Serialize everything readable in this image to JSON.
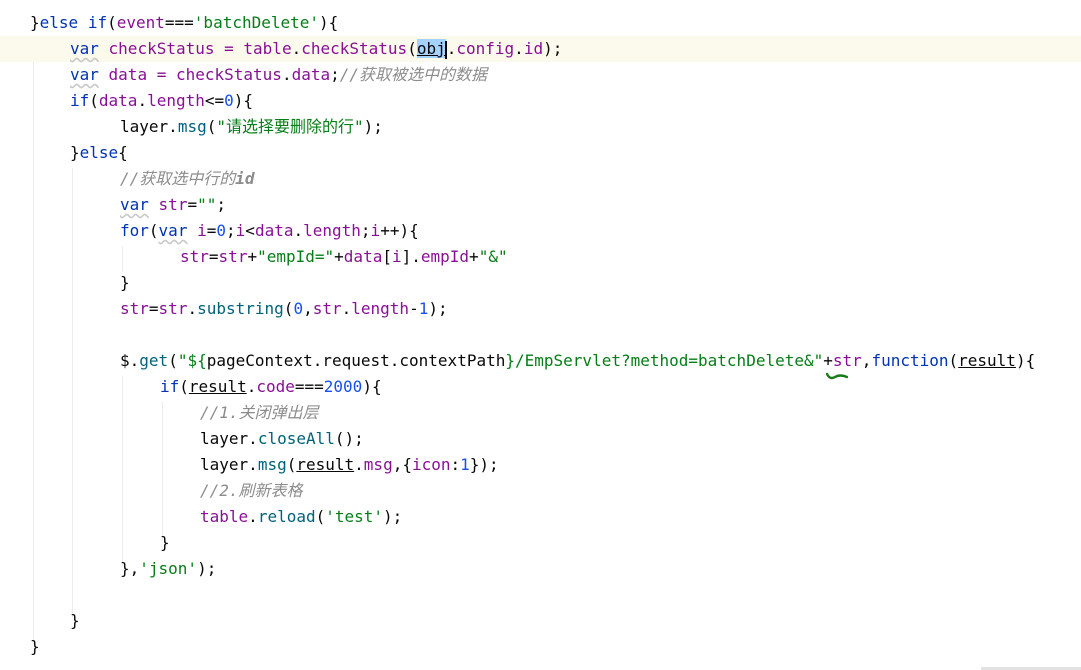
{
  "editor": {
    "lines": [
      {
        "t": "}else if(event==='batchDelete'){"
      },
      {
        "t": "    var checkStatus = table.checkStatus(obj.config.id);"
      },
      {
        "t": "    var data = checkStatus.data;//获取被选中的数据"
      },
      {
        "t": "    if(data.length<=0){"
      },
      {
        "t": "        layer.msg(\"请选择要删除的行\");"
      },
      {
        "t": "    }else{"
      },
      {
        "t": "        //获取选中行的id"
      },
      {
        "t": "        var str=\"\";"
      },
      {
        "t": "        for(var i=0;i<data.length;i++){"
      },
      {
        "t": "            str=str+\"empId=\"+data[i].empId+\"&\""
      },
      {
        "t": "        }"
      },
      {
        "t": "        str=str.substring(0,str.length-1);"
      },
      {
        "t": ""
      },
      {
        "t": "        $.get(\"${pageContext.request.contextPath}/EmpServlet?method=batchDelete&\"+str,function(result){"
      },
      {
        "t": "            if(result.code===2000){"
      },
      {
        "t": "                //1.关闭弹出层"
      },
      {
        "t": "                layer.closeAll();"
      },
      {
        "t": "                layer.msg(result.msg,{icon:1});"
      },
      {
        "t": "                //2.刷新表格"
      },
      {
        "t": "                table.reload('test');"
      },
      {
        "t": "            }"
      },
      {
        "t": "        },'json');"
      },
      {
        "t": ""
      },
      {
        "t": "    }"
      },
      {
        "t": "}"
      }
    ],
    "tokens": {
      "l0": [
        "}",
        "else",
        " ",
        "if",
        "(",
        "event",
        "===",
        "'batchDelete'",
        "){"
      ],
      "l1": [
        "var",
        " checkStatus = ",
        "table",
        ".",
        "checkStatus",
        "(",
        "obj",
        ".",
        "config",
        ".",
        "id",
        ");"
      ],
      "l2": [
        "var",
        " data = ",
        "checkStatus",
        ".",
        "data",
        ";",
        "//获取被选中的数据"
      ],
      "l3": [
        "if",
        "(",
        "data",
        ".",
        "length",
        "<=",
        "0",
        "){"
      ],
      "l4": [
        "layer",
        ".",
        "msg",
        "(",
        "\"请选择要删除的行\"",
        ");"
      ],
      "l5": [
        "}",
        "else",
        "{"
      ],
      "l6": [
        "//获取选中行的",
        "id"
      ],
      "l7": [
        "var",
        " ",
        "str",
        "=",
        "\"\"",
        ";"
      ],
      "l8": [
        "for",
        "(",
        "var",
        " ",
        "i",
        "=",
        "0",
        ";",
        "i",
        "<",
        "data",
        ".",
        "length",
        ";",
        "i",
        "++){"
      ],
      "l9": [
        "str",
        "=",
        "str",
        "+",
        "\"empId=\"",
        "+",
        "data",
        "[",
        "i",
        "].",
        "empId",
        "+",
        "\"&\""
      ],
      "l10": [
        "}"
      ],
      "l11": [
        "str",
        "=",
        "str",
        ".",
        "substring",
        "(",
        "0",
        ",",
        "str",
        ".",
        "length",
        "-",
        "1",
        ");"
      ],
      "l13": [
        "$",
        ".",
        "get",
        "(",
        "\"${",
        "pageContext.request.contextPath",
        "}",
        "/EmpServlet?method=batchDelete&\"",
        "+",
        "str",
        ",",
        "function",
        "(",
        "result",
        "){"
      ],
      "l14": [
        "if",
        "(",
        "result",
        ".",
        "code",
        "===",
        "2000",
        "){"
      ],
      "l15": [
        "//1.关闭弹出层"
      ],
      "l16": [
        "layer",
        ".",
        "closeAll",
        "();"
      ],
      "l17": [
        "layer",
        ".",
        "msg",
        "(",
        "result",
        ".",
        "msg",
        ",{",
        "icon",
        ":",
        "1",
        "});"
      ],
      "l18": [
        "//2.刷新表格"
      ],
      "l19": [
        "table",
        ".",
        "reload",
        "(",
        "'test'",
        ");"
      ],
      "l20": [
        "}"
      ],
      "l21": [
        "},",
        "'json'",
        ");"
      ],
      "l23": [
        "}"
      ],
      "l24": [
        "}"
      ]
    }
  }
}
